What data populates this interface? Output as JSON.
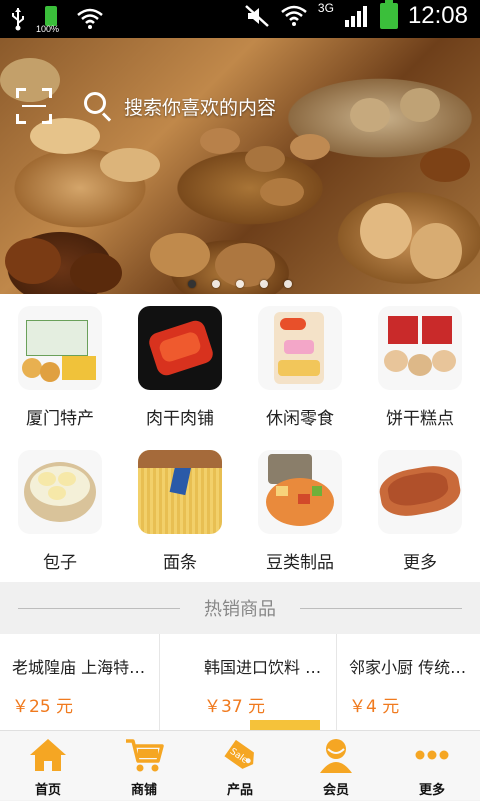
{
  "status_bar": {
    "time": "12:08",
    "battery_left": "100%",
    "network": "3G"
  },
  "banner": {
    "search_placeholder": "搜索你喜欢的内容",
    "slides": 5,
    "active_slide": 1
  },
  "categories": [
    {
      "label": "厦门特产",
      "icon": "xiamen-specialty-image"
    },
    {
      "label": "肉干肉铺",
      "icon": "jerky-image"
    },
    {
      "label": "休闲零食",
      "icon": "snacks-image"
    },
    {
      "label": "饼干糕点",
      "icon": "biscuits-image"
    },
    {
      "label": "包子",
      "icon": "baozi-image"
    },
    {
      "label": "面条",
      "icon": "noodles-image"
    },
    {
      "label": "豆类制品",
      "icon": "bean-products-image"
    },
    {
      "label": "更多",
      "icon": "more-image"
    }
  ],
  "hot": {
    "title": "热销商品"
  },
  "products": [
    {
      "name": "老城隍庙 上海特产 老…",
      "price": "￥25 元"
    },
    {
      "name": "韩国进口饮料 …",
      "price": "￥37 元"
    },
    {
      "name": "邻家小厨 传统…",
      "price": "￥4 元"
    }
  ],
  "tabbar": {
    "items": [
      {
        "label": "首页",
        "icon": "home-icon"
      },
      {
        "label": "商铺",
        "icon": "cart-icon"
      },
      {
        "label": "产品",
        "icon": "sale-tag-icon"
      },
      {
        "label": "会员",
        "icon": "member-icon"
      },
      {
        "label": "更多",
        "icon": "more-dots-icon"
      }
    ],
    "accent": "#f5a623"
  },
  "colors": {
    "price": "#f07a1e",
    "tab_icon": "#f5a623"
  }
}
